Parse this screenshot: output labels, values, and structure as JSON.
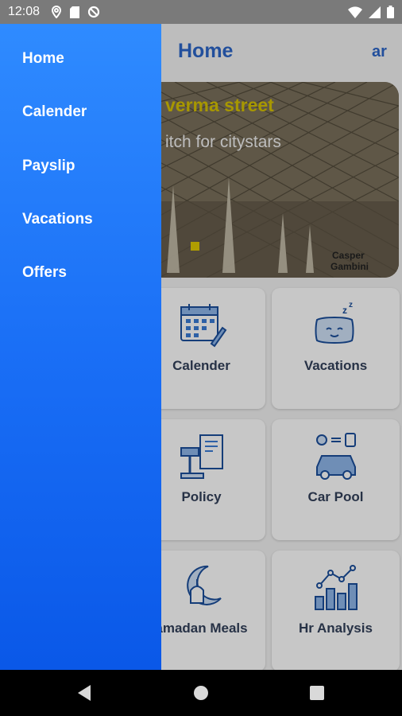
{
  "status_bar": {
    "time": "12:08"
  },
  "app_bar": {
    "title": "Home",
    "lang_toggle": "ar"
  },
  "banner": {
    "title": "verma street",
    "subtitle": "itch for citystars",
    "watermark": "Casper Gambini"
  },
  "cards": [
    {
      "label": "Calender",
      "icon": "calendar-icon"
    },
    {
      "label": "Vacations",
      "icon": "pillow-icon"
    },
    {
      "label": "Policy",
      "icon": "gavel-icon"
    },
    {
      "label": "Car Pool",
      "icon": "car-icon"
    },
    {
      "label": "amadan Meals",
      "icon": "mosque-icon"
    },
    {
      "label": "Hr Analysis",
      "icon": "bar-chart-icon"
    }
  ],
  "drawer": {
    "items": [
      {
        "label": "Home"
      },
      {
        "label": "Calender"
      },
      {
        "label": "Payslip"
      },
      {
        "label": "Vacations"
      },
      {
        "label": "Offers"
      }
    ]
  },
  "colors": {
    "accent": "#2c66c8",
    "drawer_top": "#2f8bff",
    "drawer_bottom": "#0a58e8",
    "banner_title": "#d6c200"
  }
}
